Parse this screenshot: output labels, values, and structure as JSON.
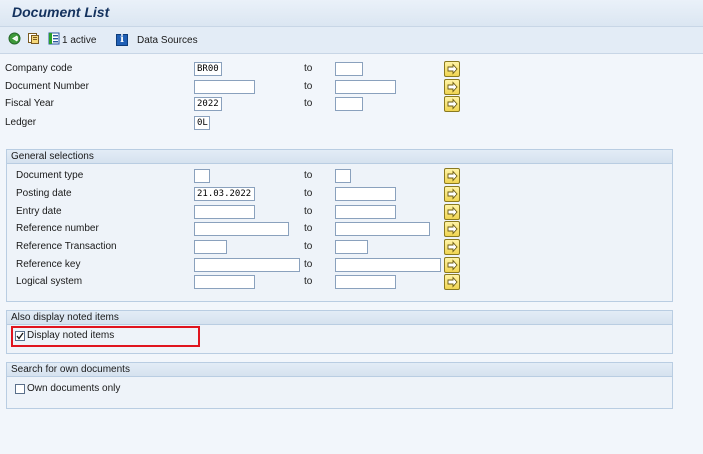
{
  "title": "Document List",
  "toolbar": {
    "active_label": "1 active",
    "data_sources_label": "Data Sources",
    "info_icon_glyph": "i"
  },
  "fields": [
    {
      "label": "Company code",
      "value": "BR00",
      "to_label": "to",
      "to_value": ""
    },
    {
      "label": "Document Number",
      "value": "",
      "to_label": "to",
      "to_value": ""
    },
    {
      "label": "Fiscal Year",
      "value": "2022",
      "to_label": "to",
      "to_value": ""
    },
    {
      "label": "Ledger",
      "value": "0L"
    }
  ],
  "general": {
    "header": "General selections",
    "fields": [
      {
        "label": "Document type",
        "value": "",
        "to_label": "to",
        "to_value": ""
      },
      {
        "label": "Posting date",
        "value": "21.03.2022",
        "to_label": "to",
        "to_value": ""
      },
      {
        "label": "Entry date",
        "value": "",
        "to_label": "to",
        "to_value": ""
      },
      {
        "label": "Reference number",
        "value": "",
        "to_label": "to",
        "to_value": ""
      },
      {
        "label": "Reference Transaction",
        "value": "",
        "to_label": "to",
        "to_value": ""
      },
      {
        "label": "Reference key",
        "value": "",
        "to_label": "to",
        "to_value": ""
      },
      {
        "label": "Logical system",
        "value": "",
        "to_label": "to",
        "to_value": ""
      }
    ]
  },
  "noted": {
    "header": "Also display noted items",
    "checkbox_label": "Display noted items",
    "checked": true,
    "highlight_color": "#e0141e"
  },
  "own": {
    "header": "Search for own documents",
    "checkbox_label": "Own documents only",
    "checked": false
  },
  "colors": {
    "title_text": "#14325e",
    "multi_button": "#f0d552"
  }
}
